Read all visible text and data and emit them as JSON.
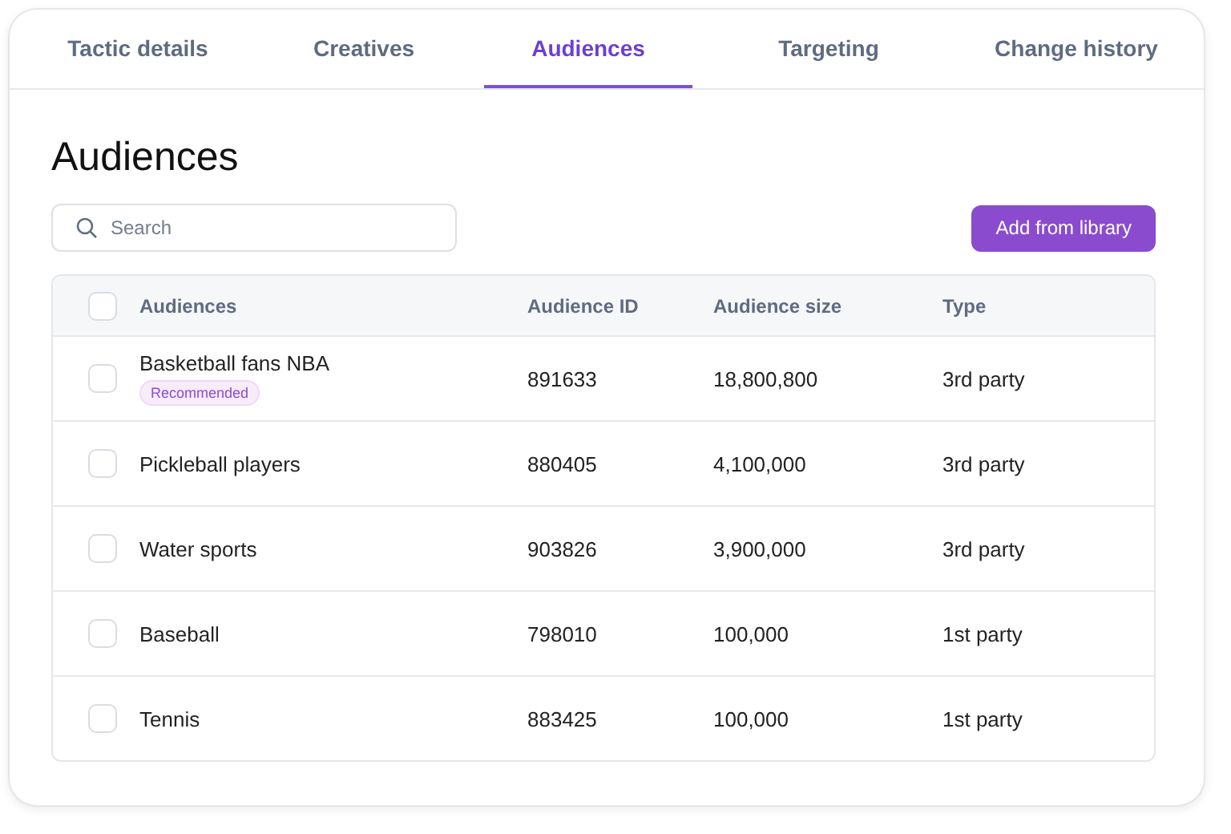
{
  "tabs": [
    {
      "label": "Tactic details",
      "selected": false
    },
    {
      "label": "Creatives",
      "selected": false
    },
    {
      "label": "Audiences",
      "selected": true
    },
    {
      "label": "Targeting",
      "selected": false
    },
    {
      "label": "Change history",
      "selected": false
    }
  ],
  "title": "Audiences",
  "search": {
    "placeholder": "Search"
  },
  "add_button": "Add from library",
  "table": {
    "select_all_checked": false,
    "columns": [
      "Audiences",
      "Audience ID",
      "Audience size",
      "Type"
    ],
    "rows": [
      {
        "name": "Basketball fans NBA",
        "badge": "Recommended",
        "id": "891633",
        "size": "18,800,800",
        "type": "3rd party",
        "checked": false
      },
      {
        "name": "Pickleball players",
        "id": "880405",
        "size": "4,100,000",
        "type": "3rd party",
        "checked": false
      },
      {
        "name": "Water sports",
        "id": "903826",
        "size": "3,900,000",
        "type": "3rd party",
        "checked": false
      },
      {
        "name": "Baseball",
        "id": "798010",
        "size": "100,000",
        "type": "1st party",
        "checked": false
      },
      {
        "name": "Tennis",
        "id": "883425",
        "size": "100,000",
        "type": "1st party",
        "checked": false
      }
    ]
  }
}
